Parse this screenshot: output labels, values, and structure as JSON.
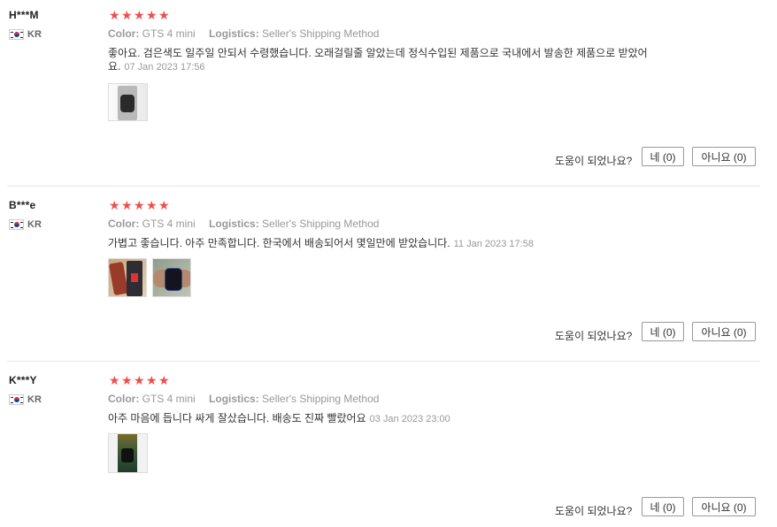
{
  "helpful_question": "도움이 되었나요?",
  "labels": {
    "color": "Color:",
    "logistics": "Logistics:"
  },
  "reviews": [
    {
      "user": "H***M",
      "country": "KR",
      "rating": 5,
      "color_value": "GTS 4 mini",
      "logistics_value": "Seller's Shipping Method",
      "content_line1": "좋아요. 검은색도 일주일 안되서 수령했습니다. 오래걸릴줄 알았는데 정식수입된 제품으로 국내에서 발송한 제품으로 받았어",
      "content_line2": "요.",
      "date": "07 Jan 2023 17:56",
      "yes_label": "네 (0)",
      "no_label": "아니요 (0)"
    },
    {
      "user": "B***e",
      "country": "KR",
      "rating": 5,
      "color_value": "GTS 4 mini",
      "logistics_value": "Seller's Shipping Method",
      "content_line1": "가볍고 좋습니다. 아주 만족합니다. 한국에서 배송되어서 몇일만에 받았습니다.",
      "date": "11 Jan 2023 17:58",
      "yes_label": "네 (0)",
      "no_label": "아니요 (0)"
    },
    {
      "user": "K***Y",
      "country": "KR",
      "rating": 5,
      "color_value": "GTS 4 mini",
      "logistics_value": "Seller's Shipping Method",
      "content_line1": "아주 마음에 듭니다 싸게 잘샀습니다. 배송도 진짜 빨랐어요",
      "date": "03 Jan 2023 23:00",
      "yes_label": "네 (0)",
      "no_label": "아니요 (0)"
    }
  ],
  "colors": {
    "star": "#f04d4d",
    "meta": "#999999",
    "divider": "#e8e8e8"
  }
}
